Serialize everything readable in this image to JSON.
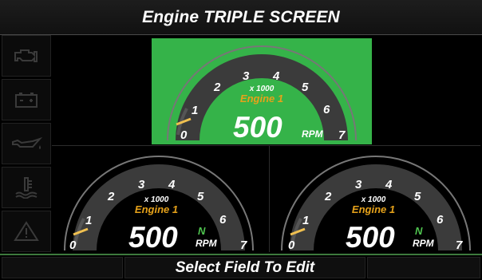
{
  "title": "Engine TRIPLE SCREEN",
  "sidebar": {
    "items": [
      {
        "icon": "check-engine-icon"
      },
      {
        "icon": "battery-icon"
      },
      {
        "icon": "oil-pressure-icon"
      },
      {
        "icon": "coolant-temperature-icon"
      },
      {
        "icon": "warning-icon"
      }
    ]
  },
  "gauges": [
    {
      "engine_label": "Engine 1",
      "multiplier": "x 1000",
      "value": "500",
      "unit": "RPM",
      "gear": "",
      "selected": true,
      "ticks": [
        "0",
        "1",
        "2",
        "3",
        "4",
        "5",
        "6",
        "7"
      ]
    },
    {
      "engine_label": "Engine 1",
      "multiplier": "x 1000",
      "value": "500",
      "unit": "RPM",
      "gear": "N",
      "selected": false,
      "ticks": [
        "0",
        "1",
        "2",
        "3",
        "4",
        "5",
        "6",
        "7"
      ]
    },
    {
      "engine_label": "Engine 1",
      "multiplier": "x 1000",
      "value": "500",
      "unit": "RPM",
      "gear": "N",
      "selected": false,
      "ticks": [
        "0",
        "1",
        "2",
        "3",
        "4",
        "5",
        "6",
        "7"
      ]
    }
  ],
  "footer": {
    "center_label": "Select Field To Edit"
  },
  "colors": {
    "selected_tile": "#35b349",
    "engine_label": "#e6a21a",
    "needle": "#f0c050",
    "gear": "#4fc34f"
  }
}
